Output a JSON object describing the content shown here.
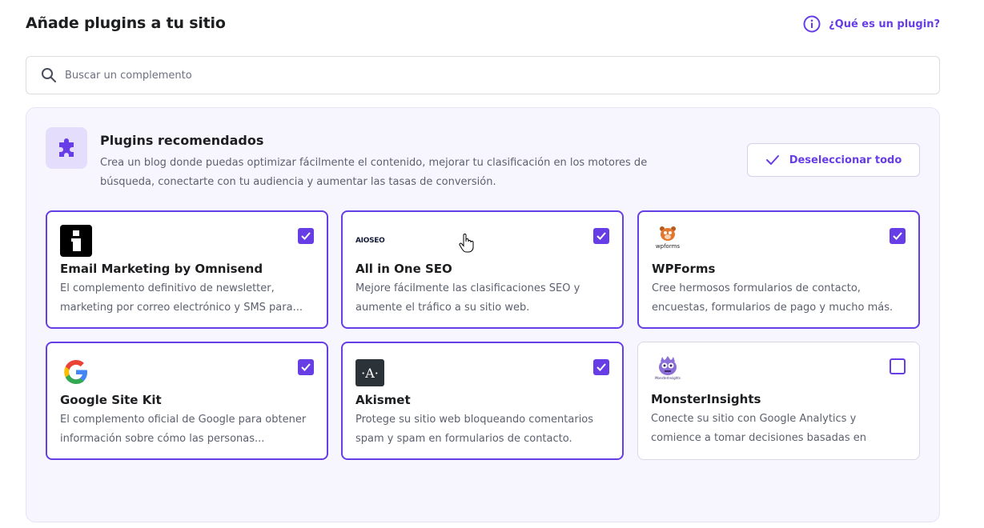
{
  "header": {
    "title": "Añade plugins a tu sitio",
    "help_link": "¿Qué es un plugin?"
  },
  "search": {
    "placeholder": "Buscar un complemento",
    "value": ""
  },
  "recommended": {
    "title": "Plugins recomendados",
    "description": "Crea un blog donde puedas optimizar fácilmente el contenido, mejorar tu clasificación en los motores de búsqueda, conectarte con tu audiencia y aumentar las tasas de conversión.",
    "deselect_label": "Deseleccionar todo"
  },
  "plugins": [
    {
      "name": "Email Marketing by Omnisend",
      "description": "El complemento definitivo de newsletter, marketing por correo electrónico y SMS para...",
      "selected": true,
      "logo": "omnisend-logo"
    },
    {
      "name": "All in One SEO",
      "description": "Mejore fácilmente las clasificaciones SEO y aumente el tráfico a su sitio web.",
      "selected": true,
      "logo": "aioseo-logo",
      "logo_text": "AIOSEO"
    },
    {
      "name": "WPForms",
      "description": "Cree hermosos formularios de contacto, encuestas, formularios de pago y mucho más.",
      "selected": true,
      "logo": "wpforms-logo",
      "logo_text": "wpforms"
    },
    {
      "name": "Google Site Kit",
      "description": "El complemento oficial de Google para obtener información sobre cómo las personas...",
      "selected": true,
      "logo": "google-logo"
    },
    {
      "name": "Akismet",
      "description": "Protege su sitio web bloqueando comentarios spam y spam en formularios de contacto.",
      "selected": true,
      "logo": "akismet-logo",
      "logo_text": "·A·"
    },
    {
      "name": "MonsterInsights",
      "description": "Conecte su sitio con Google Analytics y comience a tomar decisiones basadas en datos...",
      "selected": false,
      "logo": "monsterinsights-logo",
      "logo_text": "MonsterInsights"
    }
  ],
  "colors": {
    "accent": "#673de6",
    "panel_bg": "#f7f6fe",
    "text": "#1d1e20",
    "muted": "#5c5f6e"
  }
}
